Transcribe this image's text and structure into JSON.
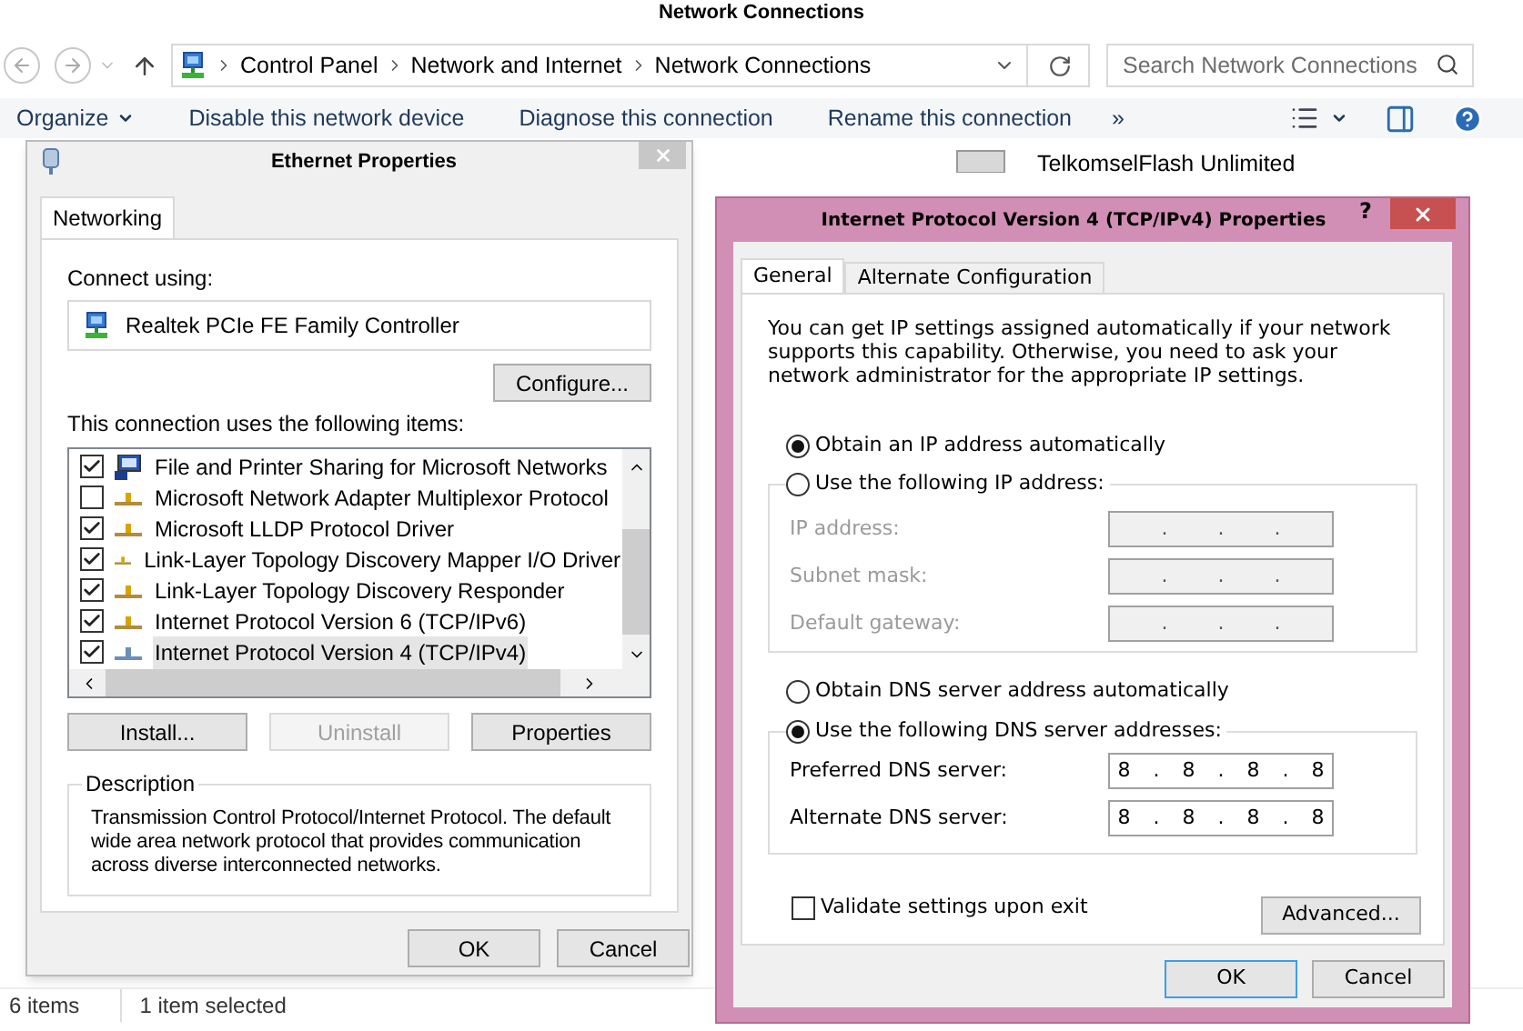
{
  "explorer": {
    "title": "Network Connections",
    "breadcrumb": [
      "Control Panel",
      "Network and Internet",
      "Network Connections"
    ],
    "search": {
      "placeholder": "Search Network Connections"
    },
    "toolbar": [
      {
        "label": "Organize",
        "kind": "menu"
      },
      {
        "label": "Disable this network device",
        "kind": "command"
      },
      {
        "label": "Diagnose this connection",
        "kind": "command"
      },
      {
        "label": "Rename this connection",
        "kind": "command"
      },
      {
        "label": "»",
        "kind": "command"
      }
    ],
    "item_name": "TelkomselFlash Unlimited",
    "status": [
      "6 items",
      "1 item selected"
    ]
  },
  "ethernet": {
    "title": "Ethernet Properties",
    "tabs": [
      {
        "label": "Networking",
        "selected": true
      }
    ],
    "connect_label": "Connect using:",
    "adapter": "Realtek PCIe FE Family Controller",
    "configure": "Configure...",
    "items_label": "This connection uses the following items:",
    "items": [
      {
        "label": "File and Printer Sharing for Microsoft Networks",
        "checked": true,
        "selected": false,
        "kind": "service"
      },
      {
        "label": "Microsoft Network Adapter Multiplexor Protocol",
        "checked": false,
        "selected": false,
        "kind": "protocol"
      },
      {
        "label": "Microsoft LLDP Protocol Driver",
        "checked": true,
        "selected": false,
        "kind": "protocol"
      },
      {
        "label": "Link-Layer Topology Discovery Mapper I/O Driver",
        "checked": true,
        "selected": false,
        "kind": "protocol"
      },
      {
        "label": "Link-Layer Topology Discovery Responder",
        "checked": true,
        "selected": false,
        "kind": "protocol"
      },
      {
        "label": "Internet Protocol Version 6 (TCP/IPv6)",
        "checked": true,
        "selected": false,
        "kind": "protocol"
      },
      {
        "label": "Internet Protocol Version 4 (TCP/IPv4)",
        "checked": true,
        "selected": true,
        "kind": "protocol"
      }
    ],
    "buttons": [
      {
        "label": "Install...",
        "disabled": false
      },
      {
        "label": "Uninstall",
        "disabled": true
      },
      {
        "label": "Properties",
        "disabled": false
      }
    ],
    "description_title": "Description",
    "description": "Transmission Control Protocol/Internet Protocol. The default wide area network protocol that provides communication across diverse interconnected networks.",
    "footer": [
      {
        "label": "OK",
        "focused": false
      },
      {
        "label": "Cancel",
        "focused": false
      }
    ]
  },
  "ipv4": {
    "title": "Internet Protocol Version 4 (TCP/IPv4) Properties",
    "help": "?",
    "tabs": [
      {
        "label": "General",
        "selected": true
      },
      {
        "label": "Alternate Configuration",
        "selected": false
      }
    ],
    "intro": "You can get IP settings assigned automatically if your network supports this capability. Otherwise, you need to ask your network administrator for the appropriate IP settings.",
    "ip_options": [
      {
        "label": "Obtain an IP address automatically",
        "selected": true
      },
      {
        "label": "Use the following IP address:",
        "selected": false
      }
    ],
    "ip_fields": [
      {
        "label": "IP address:",
        "value": ". . .",
        "disabled": true
      },
      {
        "label": "Subnet mask:",
        "value": ". . .",
        "disabled": true
      },
      {
        "label": "Default gateway:",
        "value": ". . .",
        "disabled": true
      }
    ],
    "dns_options": [
      {
        "label": "Obtain DNS server address automatically",
        "selected": false
      },
      {
        "label": "Use the following DNS server addresses:",
        "selected": true
      }
    ],
    "dns_fields": [
      {
        "label": "Preferred DNS server:",
        "value": "8 . 8 . 8 . 8",
        "disabled": false
      },
      {
        "label": "Alternate DNS server:",
        "value": "8 . 8 . 8 . 8",
        "disabled": false
      }
    ],
    "validate": {
      "label": "Validate settings upon exit",
      "checked": false
    },
    "advanced": "Advanced...",
    "footer": [
      {
        "label": "OK",
        "focused": true
      },
      {
        "label": "Cancel",
        "focused": false
      }
    ]
  }
}
